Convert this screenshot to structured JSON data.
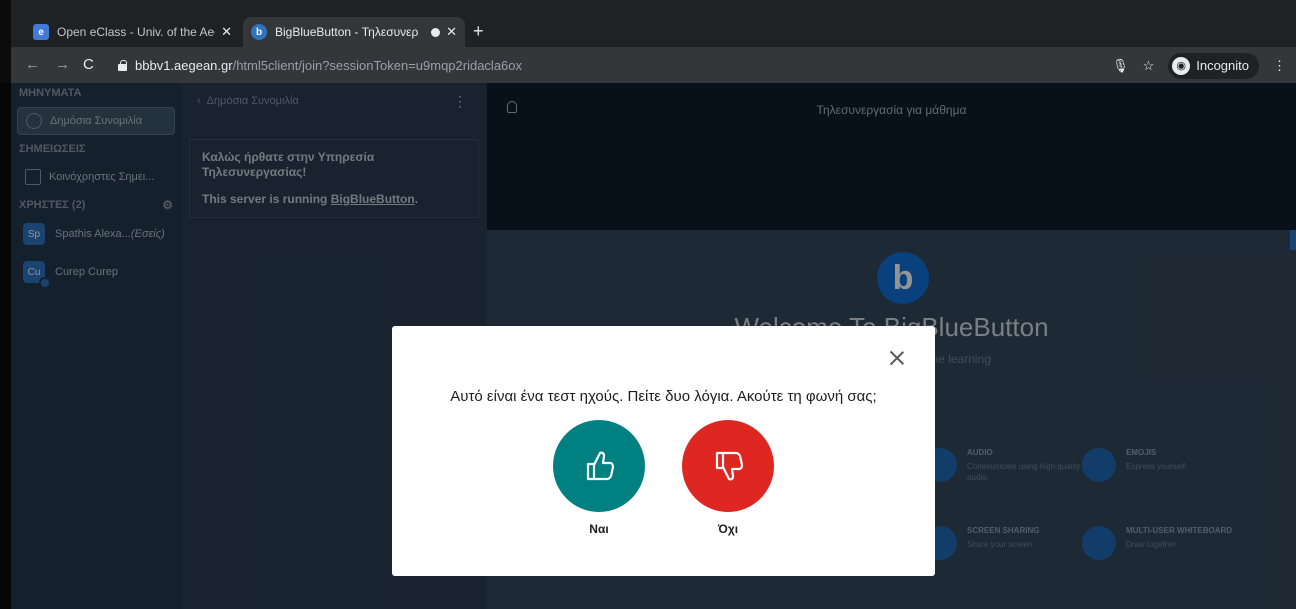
{
  "browser": {
    "tabs": [
      {
        "title": "Open eClass - Univ. of the Aege",
        "active": false
      },
      {
        "title": "BigBlueButton - Τηλεσυνερ",
        "active": true
      }
    ],
    "url_host": "bbbv1.aegean.gr",
    "url_path": "/html5client/join?sessionToken=u9mqp2ridacla6ox",
    "incognito_label": "Incognito"
  },
  "sidebar": {
    "messages_title": "ΜΗΝΥΜΑΤΑ",
    "public_chat": "Δημόσια Συνομιλία",
    "notes_title": "ΣΗΜΕΙΩΣΕΙΣ",
    "shared_notes": "Κοινόχρηστες Σημει...",
    "users_title": "ΧΡΗΣΤΕΣ (2)",
    "users": [
      {
        "initials": "Sp",
        "name": "Spathis Alexa...",
        "suffix": "(Εσείς)"
      },
      {
        "initials": "Cu",
        "name": "Curep Curep",
        "suffix": ""
      }
    ]
  },
  "chat": {
    "header": "Δημόσια Συνομιλία",
    "welcome_line1": "Καλώς ήρθατε στην Υπηρεσία",
    "welcome_line2": "Τηλεσυνεργασίας!",
    "server_prefix": "This server is running ",
    "server_link": "BigBlueButton",
    "server_suffix": "."
  },
  "main": {
    "title": "Τηλεσυνεργασία για μάθημα",
    "welcome_title": "Welcome To BigBlueButton",
    "welcome_subtitle": "...system designed for online learning",
    "features": [
      {
        "heading": "AUDIO",
        "desc": "Communicate using high quality audio."
      },
      {
        "heading": "EMOJIS",
        "desc": "Express yourself."
      },
      {
        "heading": "SCREEN SHARING",
        "desc": "Share your screen."
      },
      {
        "heading": "MULTI-USER WHITEBOARD",
        "desc": "Draw together."
      }
    ]
  },
  "modal": {
    "question": "Αυτό είναι ένα τεστ ηχούς. Πείτε δυο λόγια. Ακούτε τη φωνή σας;",
    "yes_label": "Ναι",
    "no_label": "Όχι",
    "colors": {
      "yes": "#008081",
      "no": "#df2721"
    }
  }
}
